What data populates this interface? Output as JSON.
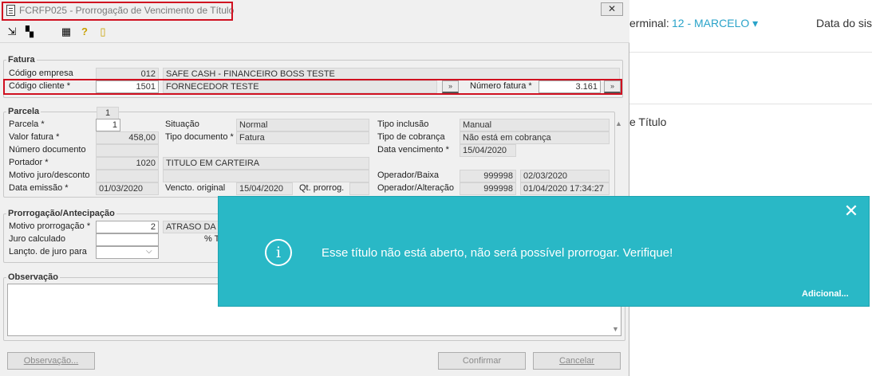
{
  "background": {
    "terminal_label": "erminal:",
    "terminal_value": "12 - MARCELO ▾",
    "date_label": "Data do sis",
    "titulo_text": "e Título"
  },
  "window": {
    "title": "FCRFP025 - Prorrogação de Vencimento de Título",
    "close": "✕"
  },
  "toolbar": {
    "icons": [
      "arrow-in-icon",
      "grid-icon",
      "calculator-icon",
      "help-icon",
      "exit-icon"
    ]
  },
  "fatura": {
    "title": "Fatura",
    "codigo_empresa_label": "Código empresa",
    "codigo_empresa": "012",
    "empresa_nome": "SAFE CASH - FINANCEIRO BOSS TESTE",
    "codigo_cliente_label": "Código cliente *",
    "codigo_cliente": "1501",
    "cliente_nome": "FORNECEDOR TESTE",
    "numero_fatura_label": "Número fatura *",
    "numero_fatura": "3.161",
    "lookup": "»"
  },
  "parcela": {
    "title": "Parcela",
    "tab": "1",
    "parcela_label": "Parcela *",
    "parcela": "1",
    "valor_label": "Valor fatura *",
    "valor": "458,00",
    "numero_doc_label": "Número documento",
    "numero_doc": "",
    "portador_label": "Portador *",
    "portador": "1020",
    "portador_nome": "TITULO EM CARTEIRA",
    "motivo_label": "Motivo juro/desconto",
    "motivo": "",
    "data_emissao_label": "Data emissão *",
    "data_emissao": "01/03/2020",
    "situacao_label": "Situação",
    "situacao": "Normal",
    "tipo_doc_label": "Tipo documento *",
    "tipo_doc": "Fatura",
    "vencto_original_label": "Vencto. original",
    "vencto_original": "15/04/2020",
    "qt_prorrog_label": "Qt. prorrog.",
    "qt_prorrog": "",
    "tipo_inclusao_label": "Tipo inclusão",
    "tipo_inclusao": "Manual",
    "tipo_cobranca_label": "Tipo de cobrança",
    "tipo_cobranca": "Não está em cobrança",
    "data_vencimento_label": "Data vencimento *",
    "data_vencimento": "15/04/2020",
    "operador_baixa_label": "Operador/Baixa",
    "operador_baixa": "999998",
    "operador_baixa_data": "02/03/2020",
    "operador_alteracao_label": "Operador/Alteração",
    "operador_alteracao": "999998",
    "operador_alteracao_data": "01/04/2020 17:34:27"
  },
  "prorrogacao": {
    "title": "Prorrogação/Antecipação",
    "motivo_label": "Motivo prorrogação *",
    "motivo": "2",
    "motivo_nome": "ATRASO DA T",
    "juro_label": "Juro calculado",
    "juro": "",
    "juro_pct": "% T",
    "lancto_label": "Lançto. de juro para",
    "lancto": ""
  },
  "observacao": {
    "title": "Observação",
    "value": ""
  },
  "buttons": {
    "observacao": "Observação...",
    "confirmar": "Confirmar",
    "cancelar": "Cancelar"
  },
  "toast": {
    "message": "Esse título não está aberto, não será possível prorrogar. Verifique!",
    "more": "Adicional...",
    "close": "✕",
    "icon": "i"
  },
  "colors": {
    "toast_bg": "#29b8c6",
    "accent": "#2aa3c9",
    "highlight": "#d01020"
  }
}
